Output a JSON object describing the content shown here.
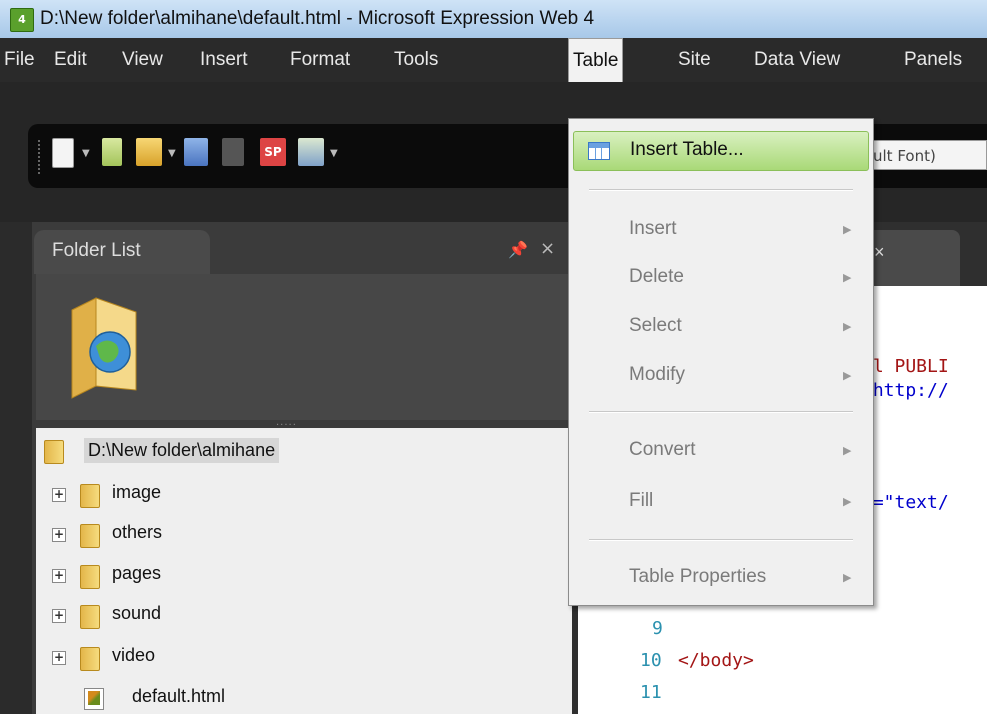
{
  "window": {
    "title": "D:\\New folder\\almihane\\default.html - Microsoft Expression Web 4",
    "app_icon_text": "4"
  },
  "menubar": {
    "items": [
      "File",
      "Edit",
      "View",
      "Insert",
      "Format",
      "Tools",
      "Table",
      "Site",
      "Data View",
      "Panels"
    ],
    "active": "Table"
  },
  "toolbar": {
    "font_box": "ult Font)"
  },
  "folder_panel": {
    "title": "Folder List",
    "root": "D:\\New folder\\almihane",
    "folders": [
      "image",
      "others",
      "pages",
      "sound",
      "video"
    ],
    "files": [
      "default.html"
    ]
  },
  "editor": {
    "tab_label": "nl ×",
    "lines": {
      "l1": "ml PUBLI",
      "l2": "'http://",
      "l3": ":=\"text/",
      "n9": "9",
      "n10": "10",
      "n11": "11",
      "body_close": "</body>"
    }
  },
  "table_menu": {
    "insert_table": "Insert Table...",
    "insert": "Insert",
    "delete": "Delete",
    "select": "Select",
    "modify": "Modify",
    "convert": "Convert",
    "fill": "Fill",
    "table_properties": "Table Properties"
  },
  "colors": {
    "menu_highlight": "#a9d977",
    "menubar_bg": "#2a2a2a",
    "titlebar_bg": "#b9d4ef"
  }
}
